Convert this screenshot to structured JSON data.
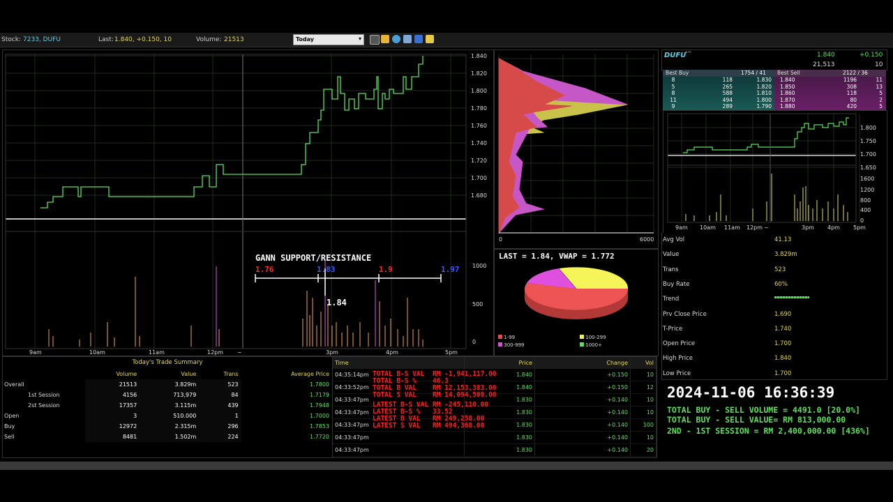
{
  "topbar": {
    "stock_label": "Stock:",
    "stock_value": "7233,  DUFU",
    "last_label": "Last:",
    "last_value": "1.840, +0.150, 10",
    "volume_label": "Volume:",
    "volume_value": "21513",
    "period_select": "Today",
    "icons": [
      "chart-icon",
      "folder-open-icon",
      "refresh-icon",
      "delete-icon",
      "save-icon",
      "edit-icon"
    ]
  },
  "main_chart": {
    "price_ticks": [
      "1.840",
      "1.820",
      "1.800",
      "1.780",
      "1.760",
      "1.740",
      "1.720",
      "1.700",
      "1.680"
    ],
    "volume_ticks": [
      "1000",
      "500",
      "0"
    ],
    "time_ticks": [
      "9am",
      "10am",
      "11am",
      "12pm",
      "~",
      "3pm",
      "4pm",
      "5pm"
    ],
    "gann": {
      "title": "GANN SUPPORT/RESISTANCE",
      "levels": [
        "1.76",
        "1.83",
        "1.9",
        "1.97"
      ],
      "current": "1.84"
    },
    "colors": {
      "price_line": "#5ee05e",
      "volume_bar": "#c98a4a",
      "volume_bar_alt": "#b34fb3"
    }
  },
  "profile_chart": {
    "x_ticks": [
      "0",
      "6000"
    ]
  },
  "pie": {
    "title": "LAST = 1.84, VWAP = 1.772",
    "legend": [
      {
        "label": "1-99",
        "color": "#e54b4b"
      },
      {
        "label": "100-299",
        "color": "#f2f24a"
      },
      {
        "label": "300-999",
        "color": "#d94fd9"
      },
      {
        "label": "1000+",
        "color": "#5ee05e"
      }
    ]
  },
  "quote": {
    "name": "DUFU",
    "name_suffix": "°^",
    "last": "1.840",
    "change": "+0.150",
    "volume": "21,513",
    "last_vol": "10",
    "best_buy_label": "Best Buy",
    "best_buy_summary": "1754 / 41",
    "best_sell_label": "Best Sell",
    "best_sell_summary": "2122 / 36",
    "depth": [
      {
        "bc": "8",
        "bq": "118",
        "bp": "1.830",
        "sp": "1.840",
        "sq": "1196",
        "sc": "11"
      },
      {
        "bc": "5",
        "bq": "265",
        "bp": "1.820",
        "sp": "1.850",
        "sq": "308",
        "sc": "13"
      },
      {
        "bc": "8",
        "bq": "588",
        "bp": "1.810",
        "sp": "1.860",
        "sq": "118",
        "sc": "5"
      },
      {
        "bc": "11",
        "bq": "494",
        "bp": "1.800",
        "sp": "1.870",
        "sq": "80",
        "sc": "2"
      },
      {
        "bc": "9",
        "bq": "289",
        "bp": "1.790",
        "sp": "1.880",
        "sq": "420",
        "sc": "5"
      }
    ]
  },
  "mini_chart": {
    "price_ticks": [
      "1.800",
      "1.750",
      "1.700",
      "1.650"
    ],
    "volume_ticks": [
      "1600",
      "1200",
      "800",
      "400",
      "0"
    ],
    "time_ticks": [
      "9am",
      "10am",
      "11am",
      "12pm",
      "~",
      "3pm",
      "4pm",
      "5pm"
    ]
  },
  "stats": [
    {
      "k": "Avg Vol",
      "v": "41.13"
    },
    {
      "k": "Value",
      "v": "3.829m"
    },
    {
      "k": "Trans",
      "v": "523"
    },
    {
      "k": "Buy Rate",
      "v": "60%"
    },
    {
      "k": "Trend",
      "v": ""
    },
    {
      "k": "Prv Close Price",
      "v": "1.690"
    },
    {
      "k": "T-Price",
      "v": "1.740"
    },
    {
      "k": "Open Price",
      "v": "1.700"
    },
    {
      "k": "High Price",
      "v": "1.840"
    },
    {
      "k": "Low Price",
      "v": "1.700"
    }
  ],
  "summary": {
    "title": "Today's Trade Summary",
    "headers": [
      "Volume",
      "Value",
      "Trans",
      "Average Price"
    ],
    "rows": [
      {
        "label": "Overall",
        "indent": false,
        "vol": "21513",
        "val": "3.829m",
        "trans": "523",
        "avg": "1.7800"
      },
      {
        "label": "1st Session",
        "indent": true,
        "vol": "4156",
        "val": "713,979",
        "trans": "84",
        "avg": "1.7179"
      },
      {
        "label": "2st Session",
        "indent": true,
        "vol": "17357",
        "val": "3.115m",
        "trans": "439",
        "avg": "1.7948"
      },
      {
        "label": "Open",
        "indent": false,
        "vol": "3",
        "val": "510.000",
        "trans": "1",
        "avg": "1.7000"
      },
      {
        "label": "Buy",
        "indent": false,
        "vol": "12972",
        "val": "2.315m",
        "trans": "296",
        "avg": "1.7853"
      },
      {
        "label": "Sell",
        "indent": false,
        "vol": "8481",
        "val": "1.502m",
        "trans": "224",
        "avg": "1.7720"
      }
    ]
  },
  "trades": {
    "headers": [
      "Time",
      "Price",
      "Change",
      "Vol"
    ],
    "rows": [
      {
        "time": "04:35:14pm",
        "price": "1.840",
        "change": "+0.150",
        "vol": "10"
      },
      {
        "time": "04:33:52pm",
        "price": "1.840",
        "change": "+0.150",
        "vol": "12"
      },
      {
        "time": "04:33:47pm",
        "price": "1.830",
        "change": "+0.140",
        "vol": "10"
      },
      {
        "time": "04:33:47pm",
        "price": "1.830",
        "change": "+0.140",
        "vol": "10"
      },
      {
        "time": "04:33:47pm",
        "price": "1.830",
        "change": "+0.140",
        "vol": "100"
      },
      {
        "time": "04:33:47pm",
        "price": "1.830",
        "change": "+0.140",
        "vol": "10"
      },
      {
        "time": "04:33:47pm",
        "price": "1.830",
        "change": "+0.140",
        "vol": "20"
      }
    ],
    "overlay": [
      {
        "k": "TOTAL B-S VAL",
        "v": "RM -1,941,117.00"
      },
      {
        "k": "TOTAL B-S %",
        "v": "46.3"
      },
      {
        "k": "TOTAL B VAL",
        "v": "RM 12,153,383.00"
      },
      {
        "k": "TOTAL S VAL",
        "v": "RM 14,094,500.00"
      },
      {
        "k": "LATEST B-S VAL",
        "v": "RM -245,110.00"
      },
      {
        "k": "LATEST B-S %",
        "v": "33.52"
      },
      {
        "k": "LATEST B VAL",
        "v": "RM 249,258.00"
      },
      {
        "k": "LATEST S VAL",
        "v": "RM 494,368.00"
      }
    ]
  },
  "footer": {
    "datetime": "2024-11-06 16:36:39",
    "line1": "TOTAL BUY - SELL VOLUME = 4491.0 [20.0%]",
    "line2": "TOTAL BUY - SELL VALUE= RM 813,000.00",
    "line3": "2ND - 1ST SESSION = RM 2,400,000.00 [436%]"
  }
}
